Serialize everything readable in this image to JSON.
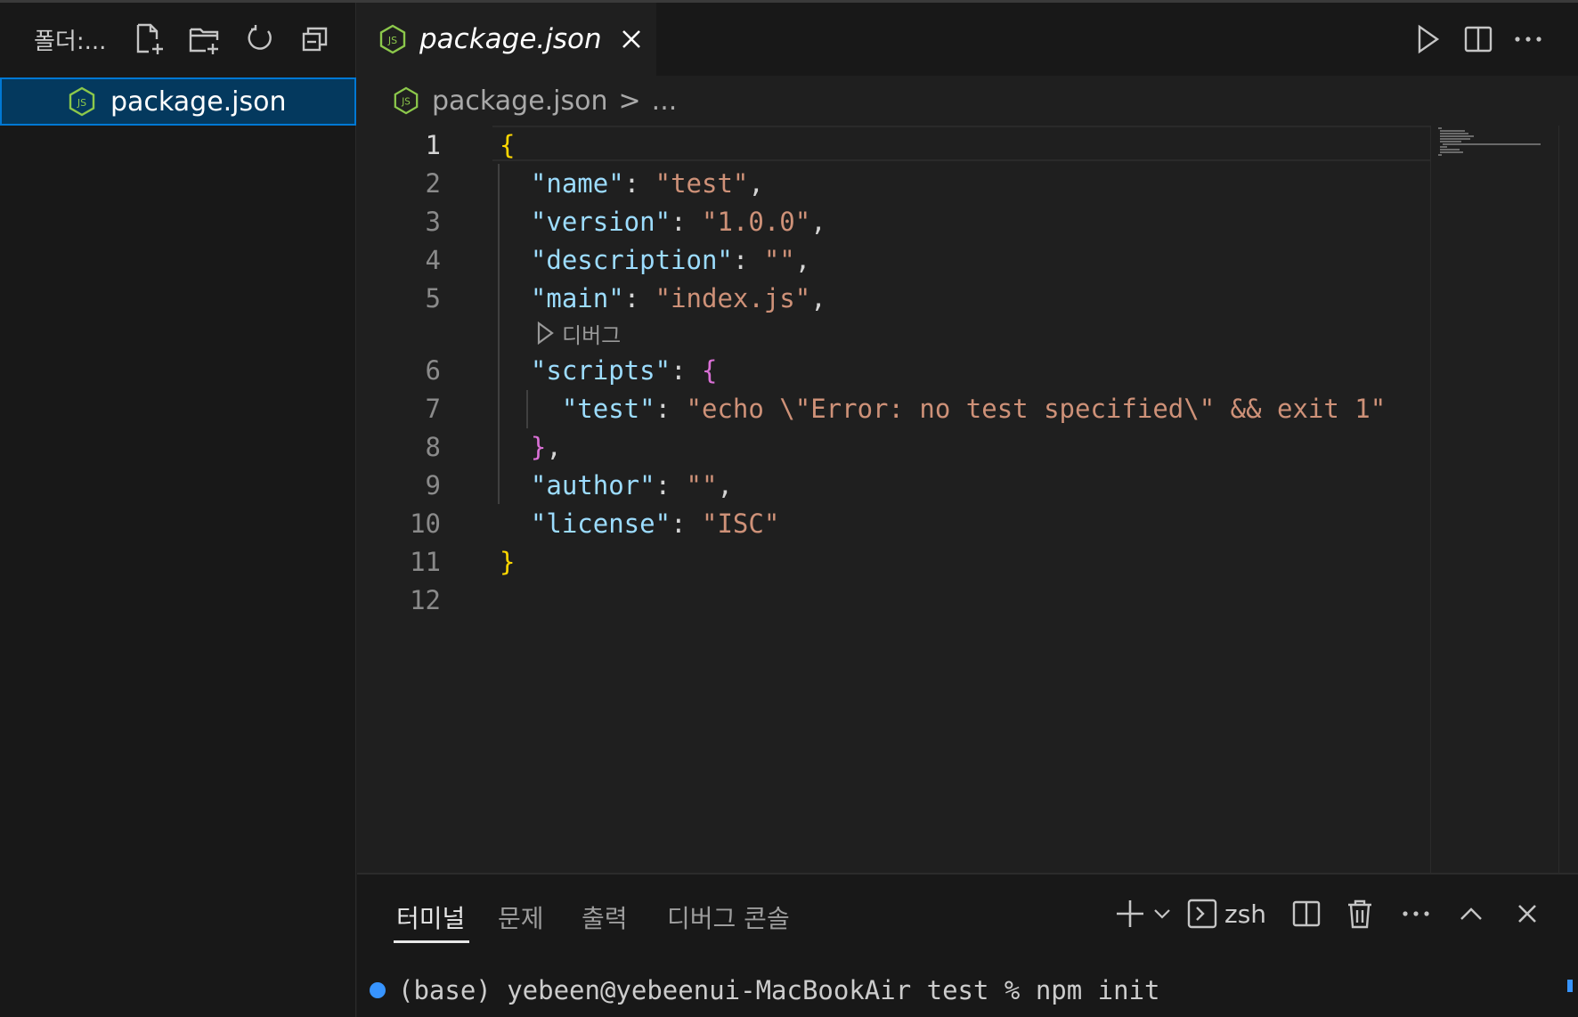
{
  "sidebar": {
    "title": "폴더:...",
    "file": "package.json",
    "icons": [
      "new-file-icon",
      "new-folder-icon",
      "refresh-icon",
      "collapse-all-icon"
    ]
  },
  "tabs": [
    {
      "label": "package.json",
      "active": true,
      "icon": "nodejs-icon"
    }
  ],
  "editor_actions": [
    "run-icon",
    "split-editor-icon",
    "more-icon"
  ],
  "breadcrumb": {
    "file": "package.json",
    "separator": ">",
    "more": "..."
  },
  "editor": {
    "lines": [
      {
        "num": "1",
        "tokens": [
          {
            "t": "{",
            "c": "b1"
          }
        ]
      },
      {
        "num": "2",
        "tokens": [
          {
            "t": "  "
          },
          {
            "t": "\"name\"",
            "c": "k"
          },
          {
            "t": ": ",
            "c": "p"
          },
          {
            "t": "\"test\"",
            "c": "s"
          },
          {
            "t": ",",
            "c": "p"
          }
        ]
      },
      {
        "num": "3",
        "tokens": [
          {
            "t": "  "
          },
          {
            "t": "\"version\"",
            "c": "k"
          },
          {
            "t": ": ",
            "c": "p"
          },
          {
            "t": "\"1.0.0\"",
            "c": "s"
          },
          {
            "t": ",",
            "c": "p"
          }
        ]
      },
      {
        "num": "4",
        "tokens": [
          {
            "t": "  "
          },
          {
            "t": "\"description\"",
            "c": "k"
          },
          {
            "t": ": ",
            "c": "p"
          },
          {
            "t": "\"\"",
            "c": "s"
          },
          {
            "t": ",",
            "c": "p"
          }
        ]
      },
      {
        "num": "5",
        "tokens": [
          {
            "t": "  "
          },
          {
            "t": "\"main\"",
            "c": "k"
          },
          {
            "t": ": ",
            "c": "p"
          },
          {
            "t": "\"index.js\"",
            "c": "s"
          },
          {
            "t": ",",
            "c": "p"
          }
        ]
      },
      {
        "num": "6",
        "tokens": [
          {
            "t": "  "
          },
          {
            "t": "\"scripts\"",
            "c": "k"
          },
          {
            "t": ": ",
            "c": "p"
          },
          {
            "t": "{",
            "c": "b2"
          }
        ]
      },
      {
        "num": "7",
        "tokens": [
          {
            "t": "    "
          },
          {
            "t": "\"test\"",
            "c": "k"
          },
          {
            "t": ": ",
            "c": "p"
          },
          {
            "t": "\"echo \\\"Error: no test specified\\\" && exit 1\"",
            "c": "s"
          }
        ]
      },
      {
        "num": "8",
        "tokens": [
          {
            "t": "  "
          },
          {
            "t": "}",
            "c": "b2"
          },
          {
            "t": ",",
            "c": "p"
          }
        ]
      },
      {
        "num": "9",
        "tokens": [
          {
            "t": "  "
          },
          {
            "t": "\"author\"",
            "c": "k"
          },
          {
            "t": ": ",
            "c": "p"
          },
          {
            "t": "\"\"",
            "c": "s"
          },
          {
            "t": ",",
            "c": "p"
          }
        ]
      },
      {
        "num": "10",
        "tokens": [
          {
            "t": "  "
          },
          {
            "t": "\"license\"",
            "c": "k"
          },
          {
            "t": ": ",
            "c": "p"
          },
          {
            "t": "\"ISC\"",
            "c": "s"
          }
        ]
      },
      {
        "num": "11",
        "tokens": [
          {
            "t": "}",
            "c": "b1"
          }
        ]
      },
      {
        "num": "12",
        "tokens": []
      }
    ],
    "codelens": "디버그"
  },
  "panel": {
    "tabs": [
      "터미널",
      "문제",
      "출력",
      "디버그 콘솔"
    ],
    "active_tab": "터미널",
    "terminal_name": "zsh",
    "icons": [
      "add-icon",
      "dropdown-icon",
      "terminal-icon",
      "split-terminal-icon",
      "trash-icon",
      "more-icon",
      "maximize-icon",
      "close-icon"
    ],
    "terminal_line": "(base) yebeen@yebeenui-MacBookAir test % npm init"
  },
  "colors": {
    "accent": "#0078d4",
    "selection": "#04395e",
    "key": "#9cdcfe",
    "string": "#ce9178",
    "bracket1": "#ffd700",
    "bracket2": "#da70d6",
    "node_green": "#8cc84b"
  }
}
